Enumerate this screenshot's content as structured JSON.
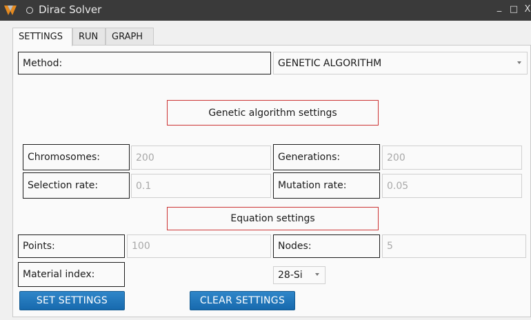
{
  "window": {
    "title": "Dirac Solver",
    "minimize": "_",
    "maximize": "□",
    "close": "X"
  },
  "tabs": [
    "SETTINGS",
    "RUN",
    "GRAPH"
  ],
  "method": {
    "label": "Method:",
    "value": "GENETIC ALGORITHM"
  },
  "ga": {
    "heading": "Genetic algorithm settings",
    "chromosomes_label": "Chromosomes:",
    "chromosomes_value": "200",
    "generations_label": "Generations:",
    "generations_value": "200",
    "selection_label": "Selection rate:",
    "selection_value": "0.1",
    "mutation_label": "Mutation rate:",
    "mutation_value": "0.05"
  },
  "eq": {
    "heading": "Equation settings",
    "points_label": "Points:",
    "points_value": "100",
    "nodes_label": "Nodes:",
    "nodes_value": "5",
    "material_label": "Material index:",
    "material_value": "28-Si"
  },
  "buttons": {
    "set": "SET  SETTINGS",
    "clear": "CLEAR SETTINGS"
  },
  "colors": {
    "accent": "#1e74b8",
    "heading_border": "#cc3333"
  }
}
